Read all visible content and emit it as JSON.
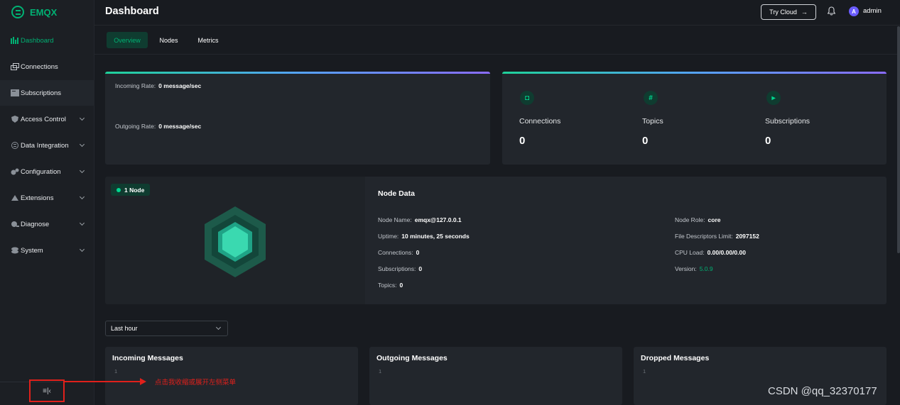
{
  "app": {
    "logo_text": "EMQX",
    "accent": "#00b173"
  },
  "sidebar": {
    "items": [
      {
        "label": "Dashboard",
        "icon": "chart-bars-icon"
      },
      {
        "label": "Connections",
        "icon": "connections-icon"
      },
      {
        "label": "Subscriptions",
        "icon": "subscriptions-icon"
      },
      {
        "label": "Access Control",
        "icon": "shield-icon"
      },
      {
        "label": "Data Integration",
        "icon": "data-integration-icon"
      },
      {
        "label": "Configuration",
        "icon": "gears-icon"
      },
      {
        "label": "Extensions",
        "icon": "extensions-icon"
      },
      {
        "label": "Diagnose",
        "icon": "diagnose-icon"
      },
      {
        "label": "System",
        "icon": "system-icon"
      }
    ],
    "collapse_icon": "≡|‹"
  },
  "header": {
    "title": "Dashboard",
    "try_cloud": "Try Cloud",
    "try_cloud_arrow": "→",
    "avatar_letter": "A",
    "user": "admin"
  },
  "tabs": [
    "Overview",
    "Nodes",
    "Metrics"
  ],
  "rates": {
    "incoming_label": "Incoming Rate:",
    "incoming_value": "0 message/sec",
    "outgoing_label": "Outgoing Rate:",
    "outgoing_value": "0 message/sec"
  },
  "stats": [
    {
      "label": "Connections",
      "value": "0",
      "icon": "connections-stat-icon",
      "glyph": "◘"
    },
    {
      "label": "Topics",
      "value": "0",
      "icon": "hash-icon",
      "glyph": "#"
    },
    {
      "label": "Subscriptions",
      "value": "0",
      "icon": "subscriptions-stat-icon",
      "glyph": "▸"
    }
  ],
  "node": {
    "badge": "1 Node",
    "title": "Node Data",
    "left": [
      {
        "label": "Node Name:",
        "value": "emqx@127.0.0.1"
      },
      {
        "label": "Uptime:",
        "value": "10 minutes, 25 seconds"
      },
      {
        "label": "Connections:",
        "value": "0"
      },
      {
        "label": "Subscriptions:",
        "value": "0"
      },
      {
        "label": "Topics:",
        "value": "0"
      }
    ],
    "right": [
      {
        "label": "Node Role:",
        "value": "core"
      },
      {
        "label": "File Descriptors Limit:",
        "value": "2097152"
      },
      {
        "label": "CPU Load:",
        "value": "0.00/0.00/0.00"
      },
      {
        "label": "Version:",
        "value": "5.0.9"
      }
    ]
  },
  "time_range": {
    "selected": "Last hour"
  },
  "metrics": [
    {
      "title": "Incoming Messages",
      "tick": "1"
    },
    {
      "title": "Outgoing Messages",
      "tick": "1"
    },
    {
      "title": "Dropped Messages",
      "tick": "1"
    }
  ],
  "annotation": {
    "text": "点击我收缩或展开左侧菜单"
  },
  "watermark": "CSDN @qq_32370177"
}
